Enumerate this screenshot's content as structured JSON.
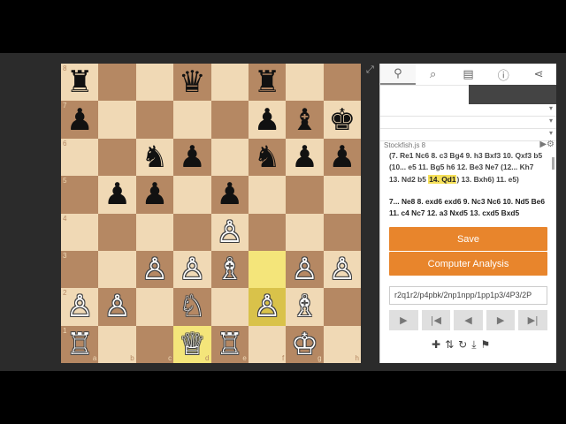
{
  "board": {
    "ranks": [
      "8",
      "7",
      "6",
      "5",
      "4",
      "3",
      "2",
      "1"
    ],
    "files": [
      "a",
      "b",
      "c",
      "d",
      "e",
      "f",
      "g",
      "h"
    ],
    "squares": [
      [
        "br",
        "",
        "",
        "bq",
        "",
        "br",
        "",
        ""
      ],
      [
        "bp",
        "",
        "",
        "",
        "",
        "bp",
        "bb",
        "bk"
      ],
      [
        "",
        "",
        "bn",
        "bp",
        "",
        "bn",
        "bp",
        "bp"
      ],
      [
        "",
        "bp",
        "bp",
        "",
        "bp",
        "",
        "",
        ""
      ],
      [
        "",
        "",
        "",
        "",
        "wp",
        "",
        "",
        ""
      ],
      [
        "",
        "",
        "wp",
        "wp",
        "wb",
        "",
        "wp",
        "wp"
      ],
      [
        "wp",
        "wp",
        "",
        "wn",
        "",
        "wp",
        "wb",
        ""
      ],
      [
        "wr",
        "",
        "",
        "wq",
        "wr",
        "",
        "wk",
        ""
      ]
    ],
    "highlighted": [
      "d1",
      "f3",
      "f2"
    ]
  },
  "pieces": {
    "wk": "♔",
    "wq": "♕",
    "wr": "♖",
    "wb": "♗",
    "wn": "♘",
    "wp": "♙",
    "bk": "♚",
    "bq": "♛",
    "br": "♜",
    "bb": "♝",
    "bn": "♞",
    "bp": "♟"
  },
  "panel": {
    "tabs": [
      {
        "name": "analysis-tab",
        "icon": "⚲",
        "active": true
      },
      {
        "name": "explorer-tab",
        "icon": "⌕",
        "active": false
      },
      {
        "name": "book-tab",
        "icon": "▤",
        "active": false
      },
      {
        "name": "info-tab",
        "icon": "ⓘ",
        "active": false
      },
      {
        "name": "share-tab",
        "icon": "⋖",
        "active": false
      }
    ],
    "engine_label": "Stockfish.js 8",
    "engine_ctrl": "▶⚙",
    "line1": {
      "a": "(7. Re1 Nc6 8. c3 Bg4 9. h3 Bxf3 10. Qxf3 b5 (10... e5 11. Bg5 h6 12. Be3 Ne7 (12... Kh7 13. Nd2 b5 ",
      "highlight": "14. Qd1",
      "b": ") 13. Bxh6) 11. e5)"
    },
    "line2": "7... Ne8 8. exd6 exd6 9. Nc3 Nc6 10. Nd5 Be6 11. c4 Nc7 12. a3 Nxd5 13. cxd5 Bxd5",
    "save_label": "Save",
    "analysis_label": "Computer Analysis",
    "fen": "r2q1r2/p4pbk/2np1npp/1pp1p3/4P3/2P",
    "nav": [
      "▶",
      "|◀",
      "◀",
      "▶",
      "▶|"
    ],
    "tools": [
      "✚",
      "⇅",
      "↻",
      "⤓",
      "⚑"
    ]
  },
  "colors": {
    "accent": "#e8852c",
    "light_square": "#f0d9b5",
    "dark_square": "#b58863",
    "highlight": "#f4e57a"
  }
}
